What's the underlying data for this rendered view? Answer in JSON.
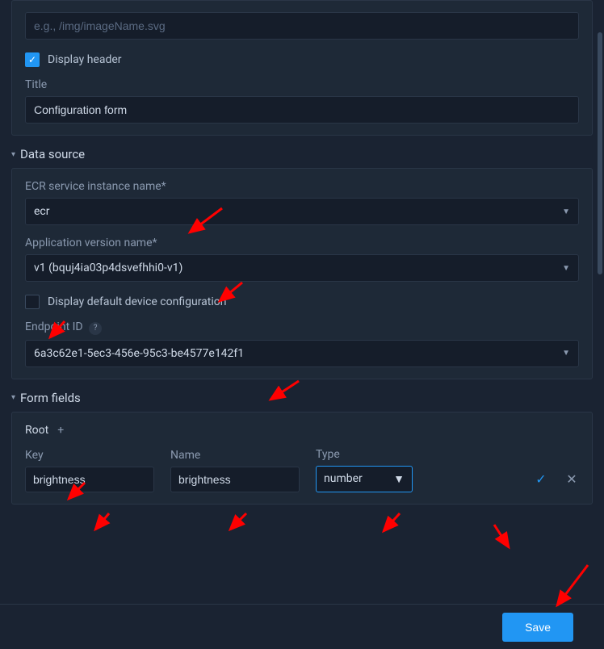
{
  "topPanel": {
    "imagePlaceholder": "e.g., /img/imageName.svg",
    "displayHeaderLabel": "Display header",
    "displayHeaderChecked": true,
    "titleLabel": "Title",
    "titleValue": "Configuration form"
  },
  "dataSource": {
    "header": "Data source",
    "ecrLabel": "ECR service instance name*",
    "ecrValue": "ecr",
    "appVersionLabel": "Application version name*",
    "appVersionValue": "v1 (bquj4ia03p4dsvefhhi0-v1)",
    "displayDefaultLabel": "Display default device configuration",
    "displayDefaultChecked": false,
    "endpointLabel": "Endpoint ID",
    "endpointValue": "6a3c62e1-5ec3-456e-95c3-be4577e142f1"
  },
  "formFields": {
    "header": "Form fields",
    "rootLabel": "Root",
    "columns": {
      "key": "Key",
      "name": "Name",
      "type": "Type"
    },
    "row": {
      "key": "brightness",
      "name": "brightness",
      "type": "number"
    }
  },
  "footer": {
    "saveLabel": "Save"
  }
}
